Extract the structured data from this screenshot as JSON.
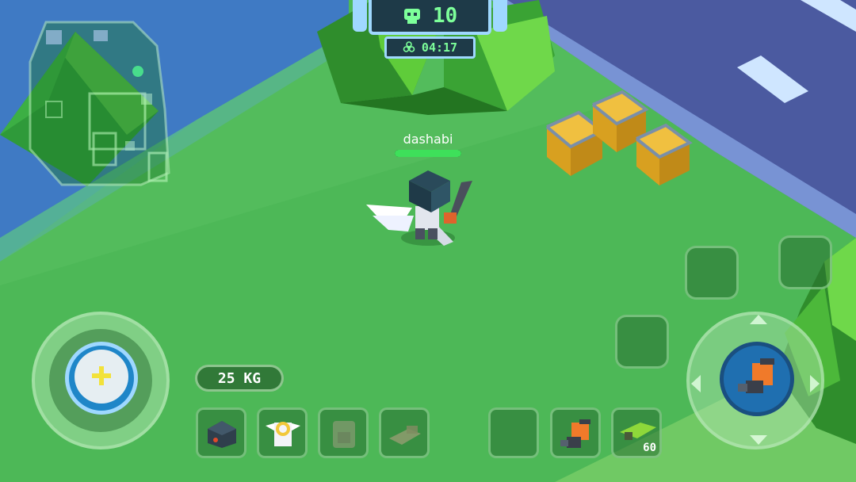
{
  "hud": {
    "players_alive": "10",
    "timer": "04:17",
    "player_name": "dashabi",
    "player_health": 1.0,
    "weight": "25 KG",
    "ammo": "60"
  },
  "icons": {
    "players": "skull-icon",
    "timer": "biohazard-icon",
    "heal": "plus-icon"
  },
  "colors": {
    "grass": "#4db857",
    "water": "#3f7ac4",
    "road": "#4b5aa0",
    "hud_text": "#7dff9a",
    "health": "#3ee05a"
  }
}
